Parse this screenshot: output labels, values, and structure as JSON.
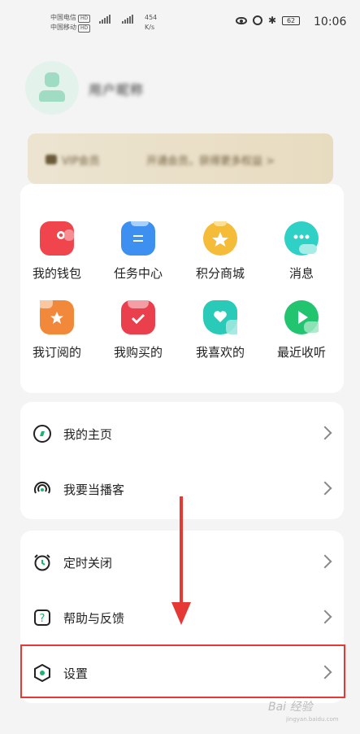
{
  "status_bar": {
    "carrier1": "中国电信",
    "carrier2": "中国移动",
    "hd_badge": "HD",
    "speed_value": "454",
    "speed_unit": "K/s",
    "battery": "62",
    "time": "10:06"
  },
  "profile": {
    "username": "用户昵称"
  },
  "vip_banner": {
    "title": "VIP会员",
    "subtitle": "开通会员，获得更多权益 >"
  },
  "quick_grid": [
    {
      "label": "我的钱包",
      "icon": "wallet-icon",
      "color": "#f0454c"
    },
    {
      "label": "任务中心",
      "icon": "task-icon",
      "color": "#3d8ff0"
    },
    {
      "label": "积分商城",
      "icon": "points-mall-icon",
      "color": "#f5bc3a"
    },
    {
      "label": "消息",
      "icon": "message-icon",
      "color": "#2fd1c7"
    },
    {
      "label": "我订阅的",
      "icon": "subscribe-icon",
      "color": "#f2893a"
    },
    {
      "label": "我购买的",
      "icon": "purchase-icon",
      "color": "#ea3f4c"
    },
    {
      "label": "我喜欢的",
      "icon": "heart-icon",
      "color": "#29cbb8"
    },
    {
      "label": "最近收听",
      "icon": "recent-play-icon",
      "color": "#23c470"
    }
  ],
  "menu_group1": [
    {
      "label": "我的主页",
      "icon": "homepage-icon"
    },
    {
      "label": "我要当播客",
      "icon": "podcast-icon"
    }
  ],
  "menu_group2": [
    {
      "label": "定时关闭",
      "icon": "timer-alarm-icon"
    },
    {
      "label": "帮助与反馈",
      "icon": "help-icon"
    },
    {
      "label": "设置",
      "icon": "settings-icon"
    }
  ],
  "watermark": {
    "text": "Bai 经验",
    "sub": "jingyan.baidu.com"
  },
  "colors": {
    "accent_green": "#1ab46e",
    "annotation_red": "#e53935",
    "vip_gold": "#e8dcc0"
  }
}
